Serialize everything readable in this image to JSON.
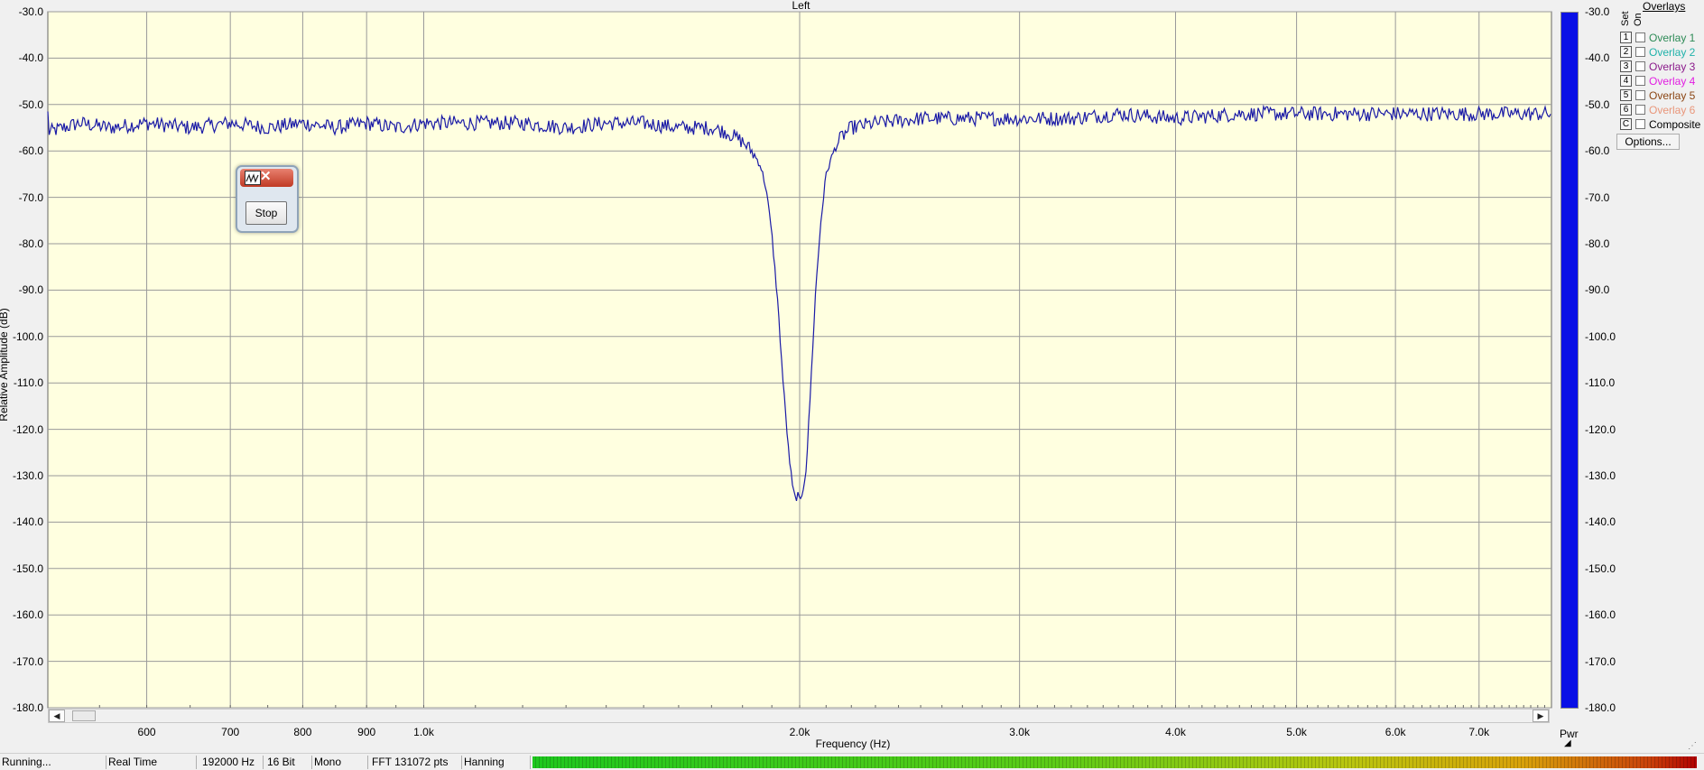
{
  "chart": {
    "title": "Left",
    "ylabel": "Relative Amplitude (dB)",
    "xlabel": "Frequency (Hz)",
    "y_ticks": [
      "-30.0",
      "-40.0",
      "-50.0",
      "-60.0",
      "-70.0",
      "-80.0",
      "-90.0",
      "-100.0",
      "-110.0",
      "-120.0",
      "-130.0",
      "-140.0",
      "-150.0",
      "-160.0",
      "-170.0",
      "-180.0"
    ],
    "x_ticks": [
      "600",
      "700",
      "800",
      "900",
      "1.0k",
      "2.0k",
      "3.0k",
      "4.0k",
      "5.0k",
      "6.0k",
      "7.0k"
    ],
    "right_ticks": [
      "-30.0",
      "-40.0",
      "-50.0",
      "-60.0",
      "-70.0",
      "-80.0",
      "-90.0",
      "-100.0",
      "-110.0",
      "-120.0",
      "-130.0",
      "-140.0",
      "-150.0",
      "-160.0",
      "-170.0",
      "-180.0"
    ],
    "pwr_label": "Pwr",
    "colors": {
      "plot_bg": "#ffffe0",
      "grid": "#9a9a9a",
      "trace": "#1a1aa6",
      "pwr_bar": "#0a10e6"
    }
  },
  "chart_data": {
    "type": "line",
    "title": "Left",
    "xlabel": "Frequency (Hz)",
    "ylabel": "Relative Amplitude (dB)",
    "x_scale": "log",
    "xlim": [
      500,
      8000
    ],
    "ylim": [
      -180,
      -30
    ],
    "grid": true,
    "x": [
      500,
      530,
      560,
      600,
      650,
      700,
      750,
      800,
      850,
      900,
      950,
      1000,
      1100,
      1200,
      1300,
      1400,
      1500,
      1600,
      1700,
      1750,
      1800,
      1830,
      1860,
      1880,
      1900,
      1920,
      1940,
      1960,
      1975,
      1985,
      1995,
      2000,
      2005,
      2015,
      2025,
      2040,
      2060,
      2080,
      2100,
      2130,
      2160,
      2200,
      2300,
      2500,
      2750,
      3000,
      3300,
      3600,
      4000,
      4500,
      5000,
      5500,
      6000,
      6500,
      7000,
      7500,
      7900
    ],
    "values": [
      -56,
      -54,
      -55,
      -54,
      -55,
      -54,
      -55,
      -54,
      -55,
      -54,
      -55,
      -54,
      -54,
      -54,
      -55,
      -54,
      -54,
      -55,
      -55,
      -56,
      -58,
      -60,
      -63,
      -68,
      -78,
      -92,
      -110,
      -125,
      -133,
      -135,
      -134,
      -136,
      -135,
      -132,
      -128,
      -112,
      -90,
      -75,
      -65,
      -60,
      -57,
      -55,
      -54,
      -53,
      -53,
      -53,
      -53,
      -52,
      -53,
      -52,
      -52,
      -52,
      -52,
      -52,
      -52,
      -52,
      -52
    ],
    "series": [
      {
        "values_ref": "values",
        "color": "#1a1aa6"
      }
    ]
  },
  "overlays": {
    "title": "Overlays",
    "set_header": "Set",
    "on_header": "On",
    "items": [
      {
        "key": "1",
        "label": "Overlay 1",
        "color": "#2e8b57"
      },
      {
        "key": "2",
        "label": "Overlay 2",
        "color": "#20b2aa"
      },
      {
        "key": "3",
        "label": "Overlay 3",
        "color": "#8b1a8b"
      },
      {
        "key": "4",
        "label": "Overlay 4",
        "color": "#e21ee2"
      },
      {
        "key": "5",
        "label": "Overlay 5",
        "color": "#8b4513"
      },
      {
        "key": "6",
        "label": "Overlay 6",
        "color": "#e9967a"
      },
      {
        "key": "C",
        "label": "Composite",
        "color": "#000000"
      }
    ],
    "options_label": "Options..."
  },
  "dialog": {
    "stop_label": "Stop"
  },
  "status": {
    "state": "Running...",
    "mode": "Real Time",
    "sample_rate": "192000 Hz",
    "bits": "16 Bit",
    "channels": "Mono",
    "fft": "FFT 131072 pts",
    "window": "Hanning"
  },
  "scrollbar": {
    "left_icon": "arrow-left-icon",
    "right_icon": "arrow-right-icon"
  }
}
